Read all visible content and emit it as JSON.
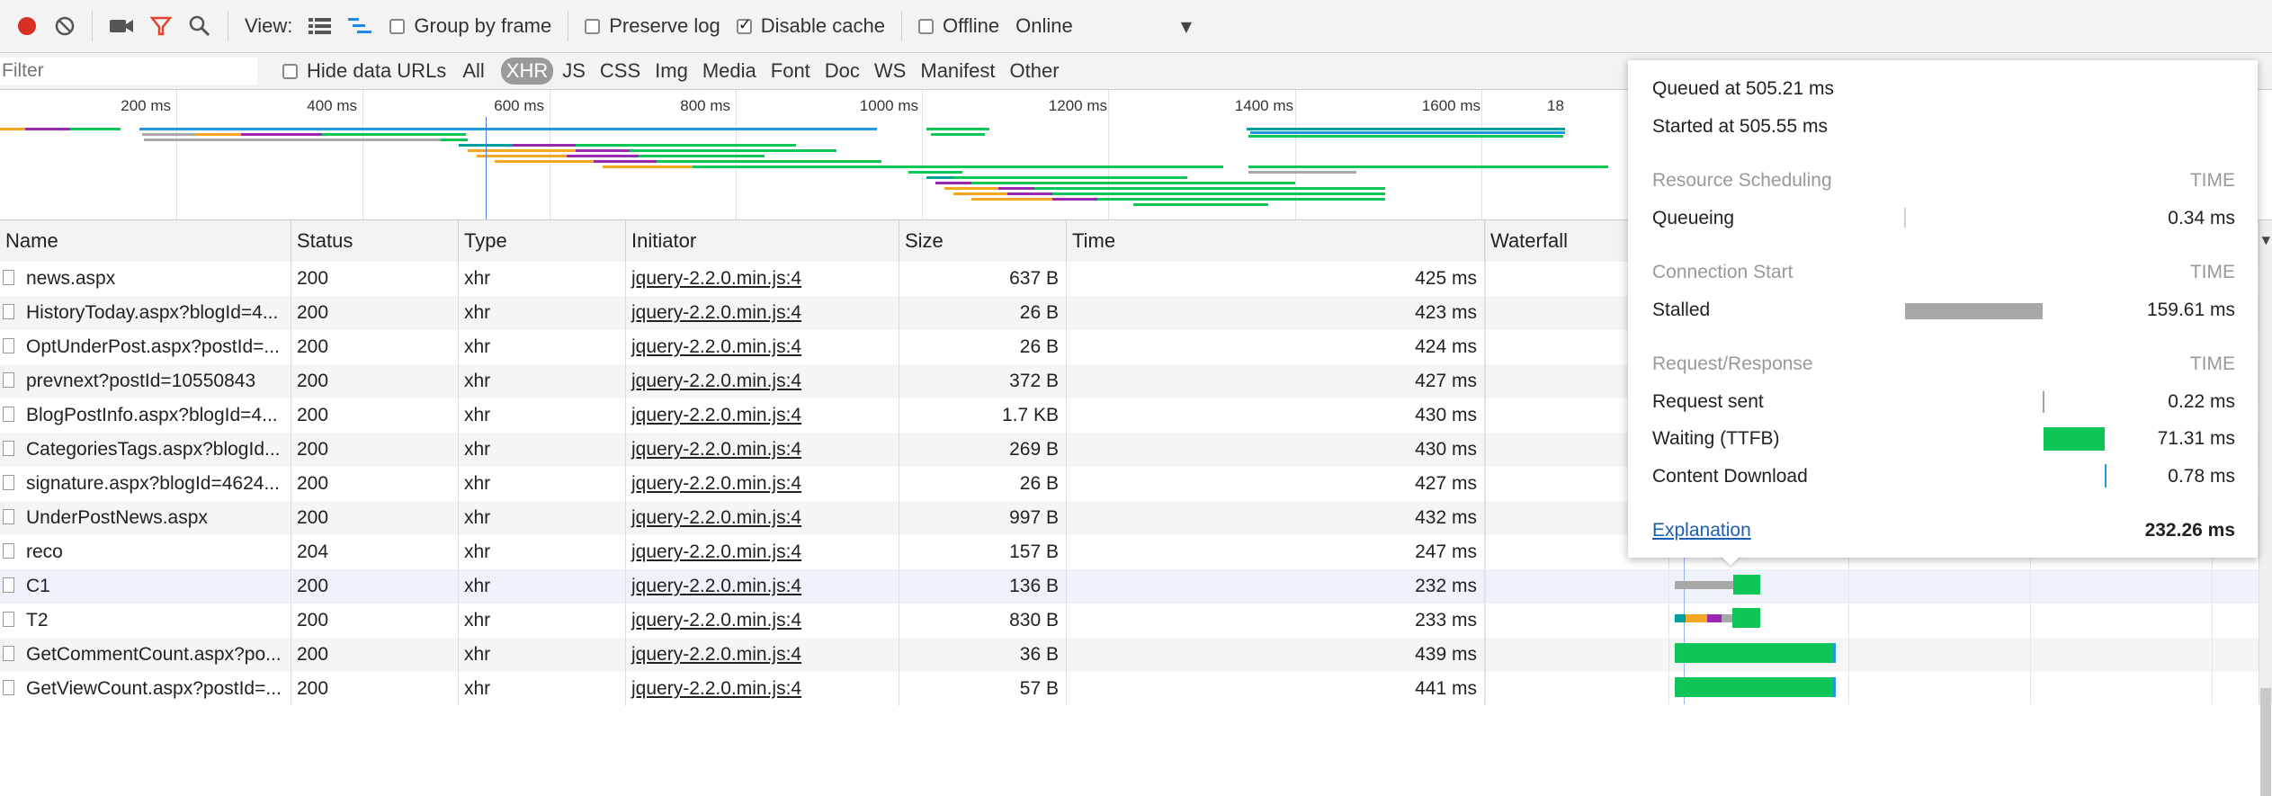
{
  "toolbar": {
    "view_label": "View:",
    "group_by_frame": "Group by frame",
    "preserve_log": "Preserve log",
    "disable_cache": "Disable cache",
    "offline": "Offline",
    "throttle": "Online"
  },
  "filterbar": {
    "placeholder": "Filter",
    "hide_data_urls": "Hide data URLs",
    "types": [
      "All",
      "XHR",
      "JS",
      "CSS",
      "Img",
      "Media",
      "Font",
      "Doc",
      "WS",
      "Manifest",
      "Other"
    ],
    "active_type": "XHR"
  },
  "overview": {
    "ticks": [
      "200 ms",
      "400 ms",
      "600 ms",
      "800 ms",
      "1000 ms",
      "1200 ms",
      "1400 ms",
      "1600 ms",
      "18"
    ]
  },
  "grid": {
    "headers": {
      "name": "Name",
      "status": "Status",
      "type": "Type",
      "initiator": "Initiator",
      "size": "Size",
      "time": "Time",
      "waterfall": "Waterfall"
    },
    "rows": [
      {
        "name": "news.aspx",
        "status": "200",
        "type": "xhr",
        "initiator": "jquery-2.2.0.min.js:4",
        "size": "637 B",
        "time": "425 ms"
      },
      {
        "name": "HistoryToday.aspx?blogId=4...",
        "status": "200",
        "type": "xhr",
        "initiator": "jquery-2.2.0.min.js:4",
        "size": "26 B",
        "time": "423 ms"
      },
      {
        "name": "OptUnderPost.aspx?postId=...",
        "status": "200",
        "type": "xhr",
        "initiator": "jquery-2.2.0.min.js:4",
        "size": "26 B",
        "time": "424 ms"
      },
      {
        "name": "prevnext?postId=10550843",
        "status": "200",
        "type": "xhr",
        "initiator": "jquery-2.2.0.min.js:4",
        "size": "372 B",
        "time": "427 ms"
      },
      {
        "name": "BlogPostInfo.aspx?blogId=4...",
        "status": "200",
        "type": "xhr",
        "initiator": "jquery-2.2.0.min.js:4",
        "size": "1.7 KB",
        "time": "430 ms"
      },
      {
        "name": "CategoriesTags.aspx?blogId...",
        "status": "200",
        "type": "xhr",
        "initiator": "jquery-2.2.0.min.js:4",
        "size": "269 B",
        "time": "430 ms"
      },
      {
        "name": "signature.aspx?blogId=4624...",
        "status": "200",
        "type": "xhr",
        "initiator": "jquery-2.2.0.min.js:4",
        "size": "26 B",
        "time": "427 ms"
      },
      {
        "name": "UnderPostNews.aspx",
        "status": "200",
        "type": "xhr",
        "initiator": "jquery-2.2.0.min.js:4",
        "size": "997 B",
        "time": "432 ms"
      },
      {
        "name": "reco",
        "status": "204",
        "type": "xhr",
        "initiator": "jquery-2.2.0.min.js:4",
        "size": "157 B",
        "time": "247 ms"
      },
      {
        "name": "C1",
        "status": "200",
        "type": "xhr",
        "initiator": "jquery-2.2.0.min.js:4",
        "size": "136 B",
        "time": "232 ms"
      },
      {
        "name": "T2",
        "status": "200",
        "type": "xhr",
        "initiator": "jquery-2.2.0.min.js:4",
        "size": "830 B",
        "time": "233 ms"
      },
      {
        "name": "GetCommentCount.aspx?po...",
        "status": "200",
        "type": "xhr",
        "initiator": "jquery-2.2.0.min.js:4",
        "size": "36 B",
        "time": "439 ms"
      },
      {
        "name": "GetViewCount.aspx?postId=...",
        "status": "200",
        "type": "xhr",
        "initiator": "jquery-2.2.0.min.js:4",
        "size": "57 B",
        "time": "441 ms"
      }
    ]
  },
  "popover": {
    "queued": "Queued at 505.21 ms",
    "started": "Started at 505.55 ms",
    "resource_scheduling": "Resource Scheduling",
    "connection_start": "Connection Start",
    "request_response": "Request/Response",
    "time_label": "TIME",
    "queueing_label": "Queueing",
    "queueing_value": "0.34 ms",
    "stalled_label": "Stalled",
    "stalled_value": "159.61 ms",
    "request_sent_label": "Request sent",
    "request_sent_value": "0.22 ms",
    "waiting_label": "Waiting (TTFB)",
    "waiting_value": "71.31 ms",
    "content_download_label": "Content Download",
    "content_download_value": "0.78 ms",
    "explanation": "Explanation",
    "total": "232.26 ms"
  },
  "colors": {
    "recording_red": "#d93025",
    "filter_red": "#e8412c",
    "waiting_green": "#0ec557",
    "stalled_gray": "#a8a8a8",
    "dns_orange": "#f5a623",
    "ssl_purple": "#9c27b0",
    "connect_teal": "#00a0a0",
    "download_blue": "#1e9be0"
  },
  "icons": [
    "record-icon",
    "clear-icon",
    "camera-icon",
    "filter-icon",
    "search-icon",
    "list-view-icon",
    "waterfall-view-icon"
  ]
}
